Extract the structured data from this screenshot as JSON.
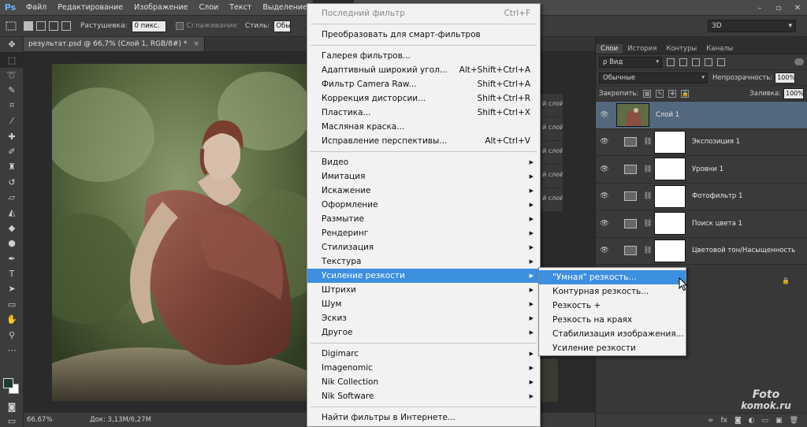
{
  "menubar": {
    "logo": "Ps",
    "items": [
      "Файл",
      "Редактирование",
      "Изображение",
      "Слои",
      "Текст",
      "Выделение",
      "Фильтр"
    ],
    "active_index": 6
  },
  "options": {
    "feather_label": "Растушевка:",
    "feather_value": "0 пикс.",
    "antialias_label": "Сглаживание",
    "style_label": "Стиль:",
    "style_value": "Обы",
    "workspace": "3D"
  },
  "document": {
    "tab_title": "результат.psd @ 66,7% (Слой 1, RGB/8#) *",
    "close": "×"
  },
  "status": {
    "zoom": "66,67%",
    "doc": "Док: 3,13M/6,27M"
  },
  "ghost_layers": [
    "й слой",
    "й слой",
    "й слой",
    "й слой",
    "й слой"
  ],
  "panel": {
    "tabs": [
      "Слои",
      "История",
      "Контуры",
      "Каналы"
    ],
    "active_tab": 0,
    "filter_kind": "ρ Вид",
    "blend_mode": "Обычные",
    "opacity_label": "Непрозрачность:",
    "opacity_value": "100%",
    "lock_label": "Закрепить:",
    "fill_label": "Заливка:",
    "fill_value": "100%",
    "layers": [
      {
        "name": "Слой 1",
        "type": "pixel",
        "selected": true
      },
      {
        "name": "Экспозиция 1",
        "type": "adjustment",
        "icon": "exposure-icon"
      },
      {
        "name": "Уровни 1",
        "type": "adjustment",
        "icon": "levels-icon"
      },
      {
        "name": "Фотофильтр 1",
        "type": "adjustment",
        "icon": "photo-filter-icon"
      },
      {
        "name": "Поиск цвета 1",
        "type": "adjustment",
        "icon": "color-lookup-icon"
      },
      {
        "name": "Цветовой тон/Насыщенность",
        "type": "adjustment",
        "icon": "hue-saturation-icon"
      }
    ],
    "bottom_icons": [
      "link-icon",
      "fx-icon",
      "mask-icon",
      "adjustment-icon",
      "folder-icon",
      "new-layer-icon",
      "trash-icon"
    ],
    "bottom_labels": [
      "∞",
      "fx",
      "◙",
      "◐",
      "▭",
      "▣",
      "🗑"
    ]
  },
  "filter_menu": {
    "items": [
      {
        "label": "Последний фильтр",
        "shortcut": "Ctrl+F",
        "disabled": true
      },
      {
        "sep": true
      },
      {
        "label": "Преобразовать для смарт-фильтров"
      },
      {
        "sep": true
      },
      {
        "label": "Галерея фильтров..."
      },
      {
        "label": "Адаптивный широкий угол...",
        "shortcut": "Alt+Shift+Ctrl+A"
      },
      {
        "label": "Фильтр Camera Raw...",
        "shortcut": "Shift+Ctrl+A"
      },
      {
        "label": "Коррекция дисторсии...",
        "shortcut": "Shift+Ctrl+R"
      },
      {
        "label": "Пластика...",
        "shortcut": "Shift+Ctrl+X"
      },
      {
        "label": "Масляная краска..."
      },
      {
        "label": "Исправление перспективы...",
        "shortcut": "Alt+Ctrl+V"
      },
      {
        "sep": true
      },
      {
        "label": "Видео",
        "submenu": true
      },
      {
        "label": "Имитация",
        "submenu": true
      },
      {
        "label": "Искажение",
        "submenu": true
      },
      {
        "label": "Оформление",
        "submenu": true
      },
      {
        "label": "Размытие",
        "submenu": true
      },
      {
        "label": "Рендеринг",
        "submenu": true
      },
      {
        "label": "Стилизация",
        "submenu": true
      },
      {
        "label": "Текстура",
        "submenu": true
      },
      {
        "label": "Усиление резкости",
        "submenu": true,
        "highlighted": true
      },
      {
        "label": "Штрихи",
        "submenu": true
      },
      {
        "label": "Шум",
        "submenu": true
      },
      {
        "label": "Эскиз",
        "submenu": true
      },
      {
        "label": "Другое",
        "submenu": true
      },
      {
        "sep": true
      },
      {
        "label": "Digimarc",
        "submenu": true
      },
      {
        "label": "Imagenomic",
        "submenu": true
      },
      {
        "label": "Nik Collection",
        "submenu": true
      },
      {
        "label": "Nik Software",
        "submenu": true
      },
      {
        "sep": true
      },
      {
        "label": "Найти фильтры в Интернете..."
      }
    ]
  },
  "sharpen_submenu": {
    "items": [
      {
        "label": "\"Умная\" резкость...",
        "highlighted": true
      },
      {
        "label": "Контурная резкость..."
      },
      {
        "label": "Резкость +"
      },
      {
        "label": "Резкость на краях"
      },
      {
        "label": "Стабилизация изображения..."
      },
      {
        "label": "Усиление резкости"
      }
    ]
  },
  "watermark": {
    "line1": "Foto",
    "line2": "komok.ru"
  },
  "colors": {
    "menu_bg": "#f2f2f2",
    "highlight": "#3d8fe0",
    "selected_layer": "#53677d",
    "app_bg": "#353535"
  }
}
